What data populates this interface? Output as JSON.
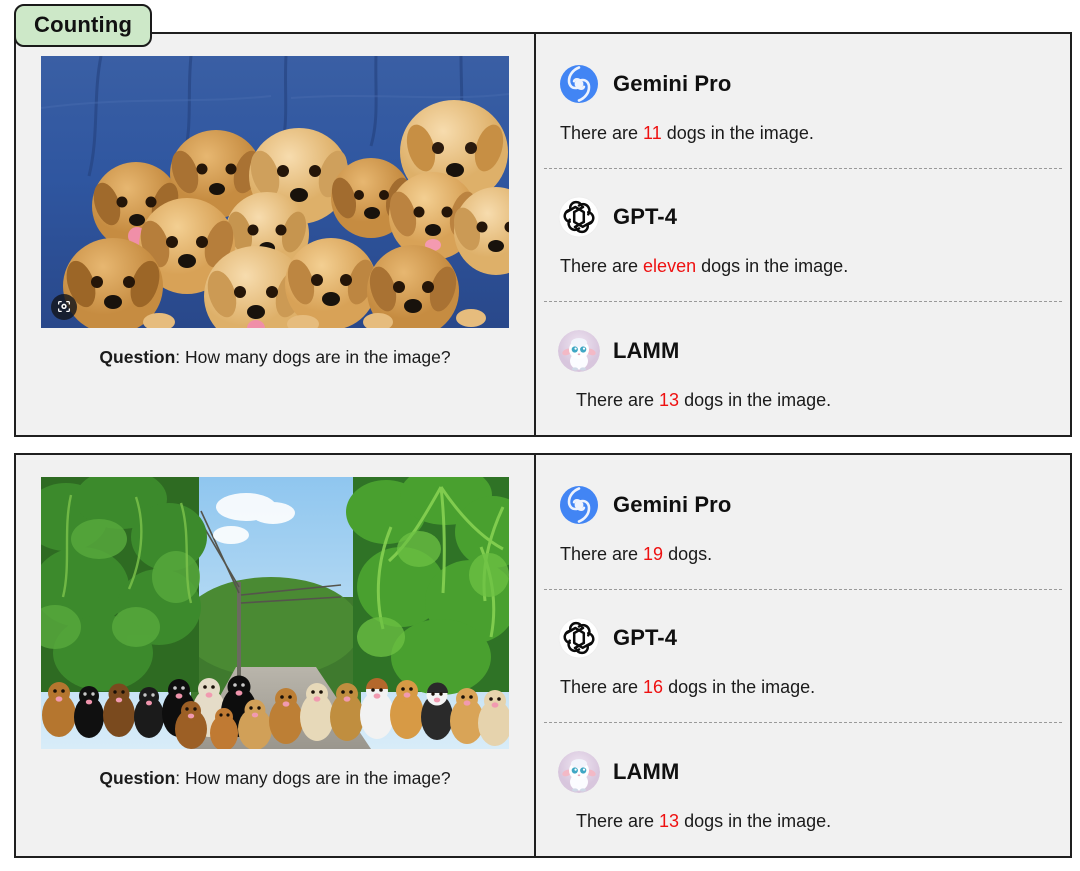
{
  "category": {
    "label": "Counting"
  },
  "colors": {
    "badge_bg": "#cde8c8",
    "panel_bg": "#f1f1f1",
    "border": "#1f1f1f",
    "highlight": "#ee1111",
    "gemini_blue": "#4285f4",
    "lamm_bg": "#e4d8e6"
  },
  "examples": [
    {
      "question_label": "Question",
      "question_text": ": How many dogs are in the image?",
      "image": {
        "alt": "A litter of golden retriever puppies piled together on a blue couch",
        "scene": "puppies-on-blue-couch",
        "overlay_icon": "google-lens-icon"
      },
      "responses": [
        {
          "model": "Gemini Pro",
          "logo": "gemini-logo",
          "answer_prefix": "There are ",
          "answer_value": "11",
          "answer_suffix": " dogs in the image.",
          "indent": false
        },
        {
          "model": "GPT-4",
          "logo": "openai-logo",
          "answer_prefix": "There are ",
          "answer_value": "eleven",
          "answer_suffix": " dogs in the image.",
          "indent": false
        },
        {
          "model": "LAMM",
          "logo": "lamm-logo",
          "answer_prefix": "There are ",
          "answer_value": "13",
          "answer_suffix": " dogs in the image.",
          "indent": true
        }
      ]
    },
    {
      "question_label": "Question",
      "question_text": ": How many dogs are in the image?",
      "image": {
        "alt": "A large group of dogs sitting in a row on a path surrounded by tropical palm foliage",
        "scene": "dogs-on-tropical-path",
        "overlay_icon": ""
      },
      "responses": [
        {
          "model": "Gemini Pro",
          "logo": "gemini-logo",
          "answer_prefix": "There are ",
          "answer_value": "19",
          "answer_suffix": " dogs.",
          "indent": false
        },
        {
          "model": "GPT-4",
          "logo": "openai-logo",
          "answer_prefix": "There are ",
          "answer_value": "16",
          "answer_suffix": " dogs in the image.",
          "indent": false
        },
        {
          "model": "LAMM",
          "logo": "lamm-logo",
          "answer_prefix": "There are ",
          "answer_value": "13",
          "answer_suffix": " dogs in the image.",
          "indent": true
        }
      ]
    }
  ]
}
